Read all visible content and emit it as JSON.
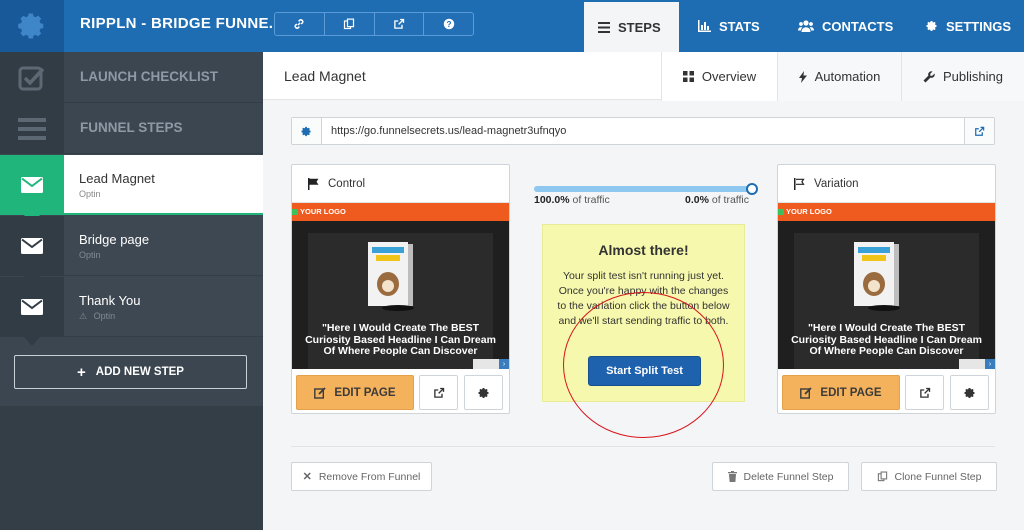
{
  "app": {
    "title": "RIPPLN - BRIDGE FUNNE..."
  },
  "header_icons": [
    "link-icon",
    "clone-icon",
    "external-link-icon",
    "help-icon"
  ],
  "nav": {
    "steps": "STEPS",
    "stats": "STATS",
    "contacts": "CONTACTS",
    "settings": "SETTINGS"
  },
  "sidebar": {
    "launch_checklist": "LAUNCH CHECKLIST",
    "funnel_steps": "FUNNEL STEPS",
    "steps": [
      {
        "name": "Lead Magnet",
        "type": "Optin"
      },
      {
        "name": "Bridge page",
        "type": "Optin"
      },
      {
        "name": "Thank You",
        "type": "Optin"
      }
    ],
    "add_step": "ADD NEW STEP"
  },
  "page": {
    "title": "Lead Magnet",
    "tabs": {
      "overview": "Overview",
      "automation": "Automation",
      "publishing": "Publishing"
    }
  },
  "url": {
    "value": "https://go.funnelsecrets.us/lead-magnetr3ufnqyo"
  },
  "control": {
    "label": "Control",
    "logo_text": "YOUR LOGO",
    "headline": "\"Here I Would Create The BEST Curiosity Based Headline I Can Dream Of Where People Can Discover",
    "edit": "EDIT PAGE"
  },
  "variation": {
    "label": "Variation",
    "logo_text": "YOUR LOGO",
    "headline": "\"Here I Would Create The BEST Curiosity Based Headline I Can Dream Of Where People Can Discover",
    "edit": "EDIT PAGE"
  },
  "traffic": {
    "control_pct": "100.0%",
    "variation_pct": "0.0%",
    "suffix": "of traffic",
    "slider_fraction": 1.0
  },
  "notice": {
    "title": "Almost there!",
    "body": "Your split test isn't running just yet. Once you're happy with the changes to the variation click the button below and we'll start sending traffic to both.",
    "button": "Start Split Test"
  },
  "footer": {
    "remove": "Remove From Funnel",
    "delete": "Delete Funnel Step",
    "clone": "Clone Funnel Step"
  },
  "colors": {
    "brand_blue": "#1e6db3",
    "active_green": "#20b57a",
    "edit_orange": "#f5b25c",
    "notice_yellow": "#f6f8ad",
    "annotation_red": "#d8141b"
  }
}
